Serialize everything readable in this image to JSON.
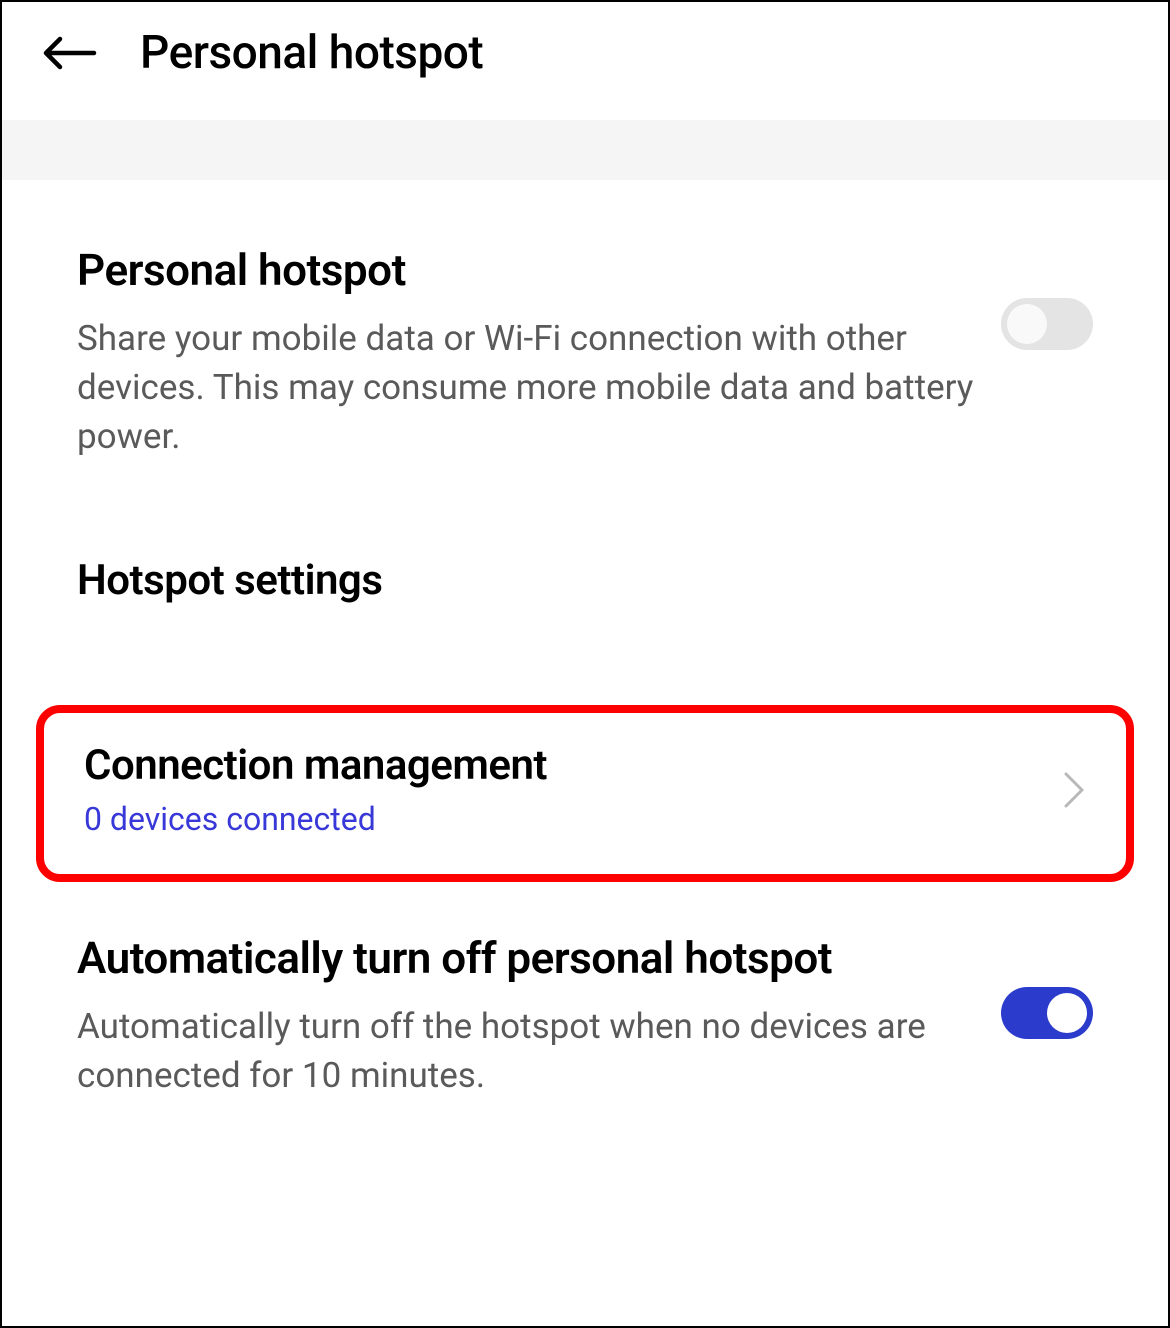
{
  "header": {
    "title": "Personal hotspot"
  },
  "personal_hotspot": {
    "title": "Personal hotspot",
    "description": "Share your mobile data or Wi-Fi connection with other devices. This may consume more mobile data and battery power.",
    "enabled": false
  },
  "hotspot_settings_label": "Hotspot settings",
  "connection_management": {
    "title": "Connection management",
    "status": "0 devices connected"
  },
  "auto_off": {
    "title": "Automatically turn off personal hotspot",
    "description": "Automatically turn off the hotspot when no devices are connected for 10 minutes.",
    "enabled": true
  },
  "colors": {
    "accent": "#2b3ccc",
    "link": "#3838d8",
    "highlight_border": "#ff0000",
    "toggle_off": "#e4e4e4"
  }
}
